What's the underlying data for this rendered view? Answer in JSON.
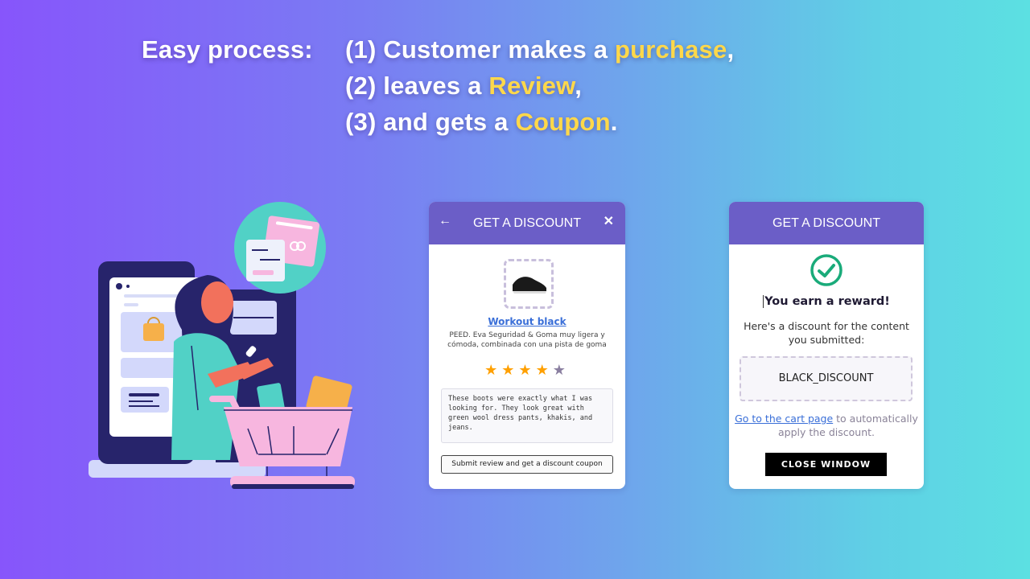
{
  "headline": {
    "label": "Easy process:",
    "steps": [
      {
        "prefix": "(1) Customer makes a ",
        "highlight": "purchase",
        "suffix": ","
      },
      {
        "prefix": "(2) leaves a ",
        "highlight": "Review",
        "suffix": ","
      },
      {
        "prefix": "(3) and gets a ",
        "highlight": "Coupon",
        "suffix": "."
      }
    ],
    "highlight_color": "#ffd84a"
  },
  "review_widget": {
    "title": "GET A DISCOUNT",
    "back_icon": "arrow-left-icon",
    "close_icon": "close-icon",
    "product": {
      "name": "Workout black",
      "description": "PEED. Eva Seguridad & Goma muy ligera y cómoda, combinada con una pista de goma"
    },
    "rating": {
      "value": 4,
      "max": 5,
      "stars": [
        "★",
        "★",
        "★",
        "★",
        "★"
      ]
    },
    "review_text": "These boots were exactly what I was looking for. They look great with green wool dress pants, khakis, and jeans.",
    "submit_label": "Submit review and get a discount coupon"
  },
  "reward_widget": {
    "title": "GET A DISCOUNT",
    "success_icon": "check-circle-icon",
    "heading": "You earn a reward!",
    "subtext": "Here's a discount for the content you submitted:",
    "coupon_code": "BLACK_DISCOUNT",
    "cart_link": "Go to the cart page",
    "cart_suffix": " to automatically apply the discount.",
    "close_label": "CLOSE WINDOW"
  },
  "colors": {
    "header_purple": "#6b5ec7",
    "star_active": "#ffa000",
    "star_inactive": "#8a7fa0",
    "success_green": "#1aab7a",
    "link_blue": "#3a6fd8"
  }
}
